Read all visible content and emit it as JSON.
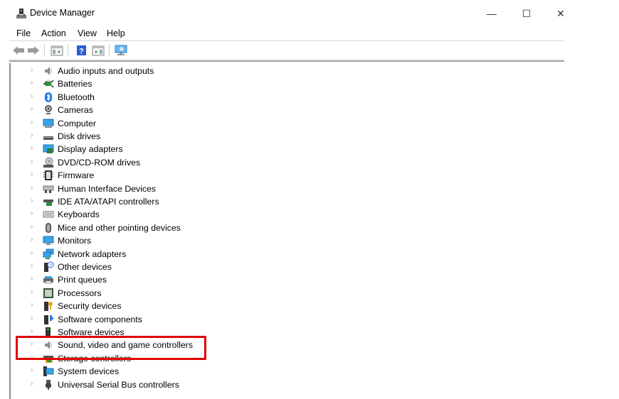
{
  "window": {
    "title": "Device Manager",
    "icon": "device-manager-icon",
    "controls": {
      "minimize": "—",
      "maximize": "☐",
      "close": "✕"
    }
  },
  "menu": [
    "File",
    "Action",
    "View",
    "Help"
  ],
  "toolbar": {
    "buttons": [
      "back-arrow-icon",
      "forward-arrow-icon",
      "show-hide-console-tree-icon",
      "help-icon",
      "properties-pane-icon",
      "scan-hardware-monitor-icon"
    ]
  },
  "tree": {
    "items": [
      {
        "label": "Audio inputs and outputs",
        "icon": "speaker-icon"
      },
      {
        "label": "Batteries",
        "icon": "battery-icon"
      },
      {
        "label": "Bluetooth",
        "icon": "bluetooth-icon"
      },
      {
        "label": "Cameras",
        "icon": "camera-icon"
      },
      {
        "label": "Computer",
        "icon": "computer-icon"
      },
      {
        "label": "Disk drives",
        "icon": "disk-drive-icon"
      },
      {
        "label": "Display adapters",
        "icon": "display-adapter-icon"
      },
      {
        "label": "DVD/CD-ROM drives",
        "icon": "dvd-drive-icon"
      },
      {
        "label": "Firmware",
        "icon": "firmware-chip-icon"
      },
      {
        "label": "Human Interface Devices",
        "icon": "hid-icon"
      },
      {
        "label": "IDE ATA/ATAPI controllers",
        "icon": "ide-controller-icon"
      },
      {
        "label": "Keyboards",
        "icon": "keyboard-icon"
      },
      {
        "label": "Mice and other pointing devices",
        "icon": "mouse-icon"
      },
      {
        "label": "Monitors",
        "icon": "monitor-icon"
      },
      {
        "label": "Network adapters",
        "icon": "network-adapter-icon"
      },
      {
        "label": "Other devices",
        "icon": "unknown-device-icon"
      },
      {
        "label": "Print queues",
        "icon": "printer-icon"
      },
      {
        "label": "Processors",
        "icon": "processor-icon"
      },
      {
        "label": "Security devices",
        "icon": "security-key-icon"
      },
      {
        "label": "Software components",
        "icon": "software-component-icon"
      },
      {
        "label": "Software devices",
        "icon": "software-device-icon"
      },
      {
        "label": "Sound, video and game controllers",
        "icon": "speaker-icon",
        "highlighted": true
      },
      {
        "label": "Storage controllers",
        "icon": "storage-controller-icon"
      },
      {
        "label": "System devices",
        "icon": "system-devices-icon"
      },
      {
        "label": "Universal Serial Bus controllers",
        "icon": "usb-icon"
      }
    ]
  },
  "colors": {
    "highlight_border": "#e00000"
  }
}
